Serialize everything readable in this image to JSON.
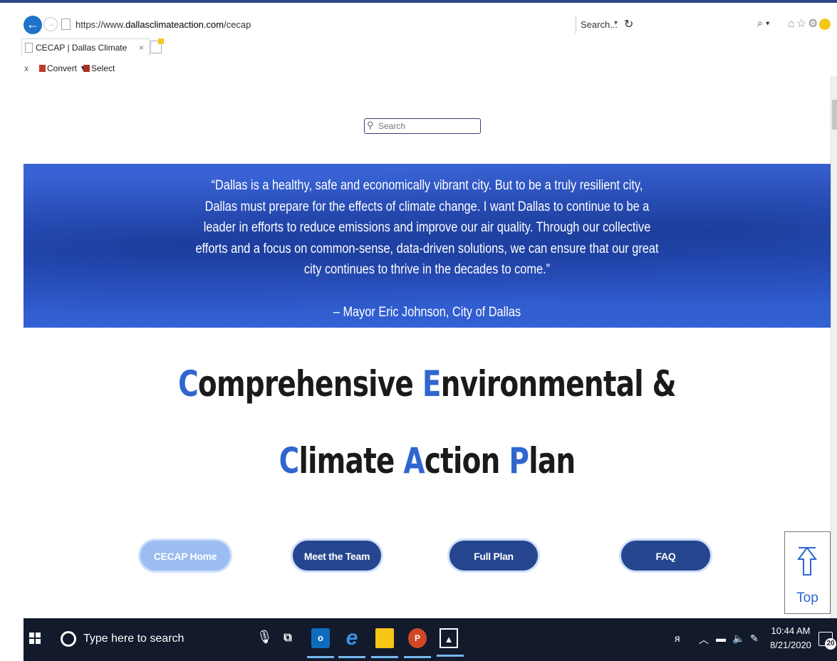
{
  "browser": {
    "url_prefix": "https://www.",
    "url_domain": "dallasclimateaction.com",
    "url_path": "/cecap",
    "search_placeholder": "Search...",
    "tab_title": "CECAP | Dallas Climate",
    "tab_close": "×",
    "cmd_close": "x",
    "convert_label": "Convert",
    "convert_arrow": "▼",
    "select_label": "Select"
  },
  "site": {
    "search_placeholder": "Search",
    "quote": [
      "“Dallas is a healthy, safe and economically vibrant city. But to be a truly resilient city,",
      "Dallas must prepare for the effects of climate change. I want Dallas to continue to be a",
      "leader in efforts to reduce emissions and improve our air quality. Through our collective",
      "efforts and a focus on common-sense, data-driven solutions, we can ensure that our great",
      "city continues to thrive in the decades to come.”"
    ],
    "attribution": "– Mayor Eric Johnson, City of Dallas",
    "headline": {
      "line1": [
        {
          "letter": "C",
          "rest": "omprehensive "
        },
        {
          "letter": "E",
          "rest": "nvironmental &"
        }
      ],
      "line2": [
        {
          "letter": "C",
          "rest": "limate "
        },
        {
          "letter": "A",
          "rest": "ction "
        },
        {
          "letter": "P",
          "rest": "lan"
        }
      ]
    },
    "nav": {
      "home": "CECAP Home",
      "team": "Meet the Team",
      "plan": "Full Plan",
      "faq": "FAQ"
    },
    "top_label": "Top"
  },
  "taskbar": {
    "search_placeholder": "Type here to search",
    "time": "10:44 AM",
    "date": "8/21/2020",
    "notification_count": "20"
  },
  "colors": {
    "accent_blue": "#2f66d0",
    "nav_dark": "#25468f",
    "nav_light": "#9bbdf2",
    "hero_blue": "#2c55c8"
  }
}
